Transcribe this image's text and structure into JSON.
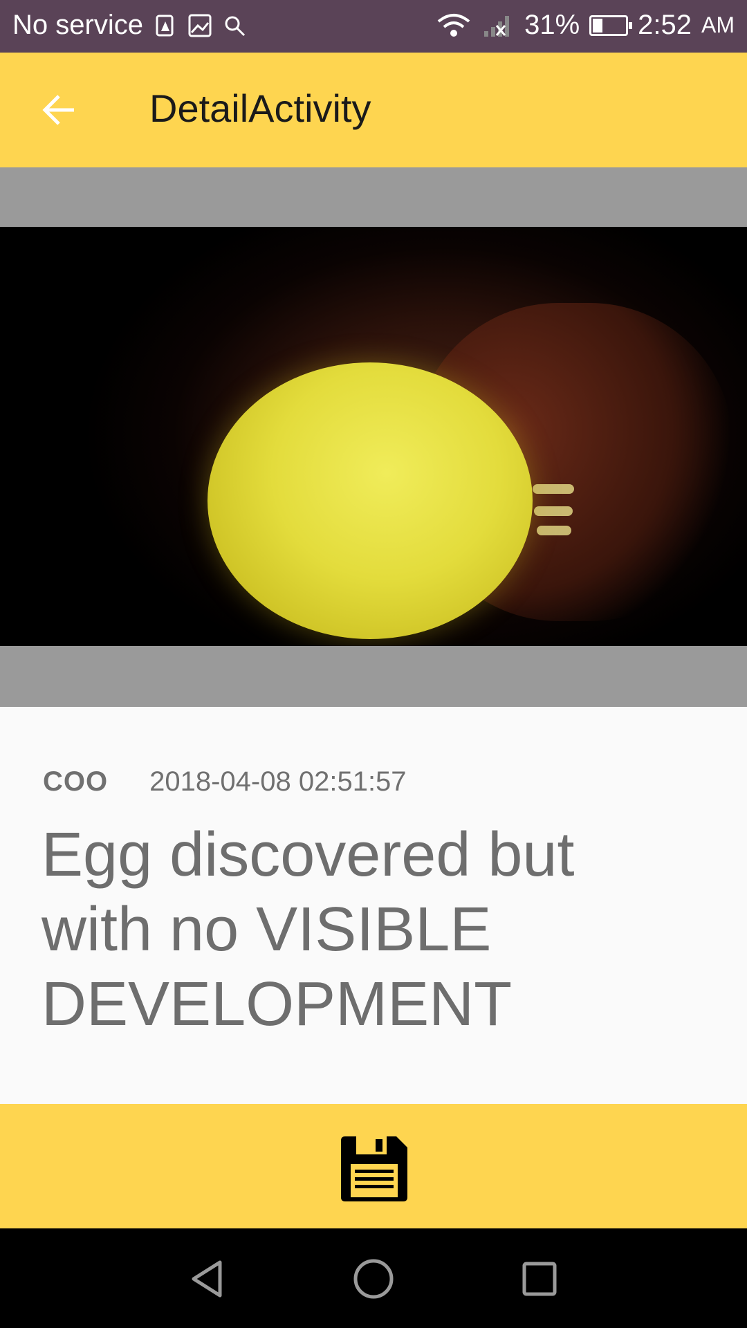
{
  "status_bar": {
    "carrier": "No service",
    "battery_percent": "31%",
    "battery_level": 0.31,
    "time": "2:52",
    "ampm": "AM",
    "icons": [
      "sim-alert-icon",
      "image-icon",
      "search-icon",
      "wifi-icon",
      "signal-icon",
      "battery-icon"
    ]
  },
  "app_bar": {
    "title": "DetailActivity",
    "back_icon": "arrow-left-icon"
  },
  "entry": {
    "user": "COO",
    "timestamp": "2018-04-08 02:51:57",
    "description": "Egg discovered but with no VISIBLE DEVELOPMENT",
    "image_subject": "candled egg photo"
  },
  "actions": {
    "save_icon": "floppy-disk-icon"
  },
  "nav_bar": {
    "icons": [
      "back-triangle-icon",
      "home-circle-icon",
      "recents-square-icon"
    ]
  },
  "colors": {
    "accent": "#fed550",
    "status_bar": "#5a4357",
    "text_secondary": "#6e6e6e"
  }
}
